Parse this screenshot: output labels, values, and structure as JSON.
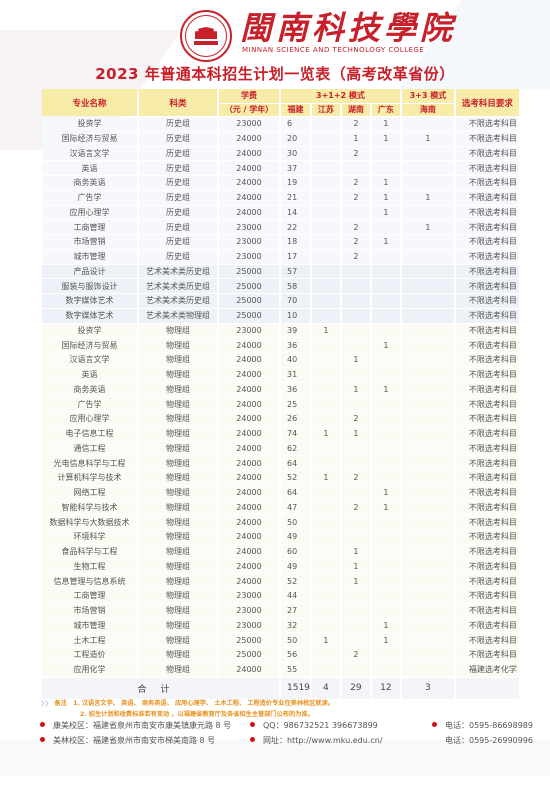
{
  "header": {
    "school_name": "閩南科技學院",
    "school_name_en": "MINNAN SCIENCE AND TECHNOLOGY COLLEGE",
    "title": "2023 年普通本科招生计划一览表（高考改革省份）"
  },
  "table": {
    "headers": {
      "major": "专业名称",
      "category": "科类",
      "fee": "学费",
      "fee_unit": "（元 / 学年）",
      "mode_312": "3+1+2 模式",
      "mode_33": "3+3 模式",
      "fujian": "福建",
      "jiangsu": "江苏",
      "hunan": "湖南",
      "guangdong": "广东",
      "hainan": "海南",
      "requirement": "选考科目要求"
    },
    "rows": [
      {
        "group": "hist",
        "major": "投资学",
        "category": "历史组",
        "fee": "23000",
        "fujian": "6",
        "jiangsu": "",
        "hunan": "2",
        "guangdong": "1",
        "hainan": "",
        "requirement": "不限选考科目"
      },
      {
        "group": "hist",
        "major": "国际经济与贸易",
        "category": "历史组",
        "fee": "24000",
        "fujian": "20",
        "jiangsu": "",
        "hunan": "1",
        "guangdong": "1",
        "hainan": "1",
        "requirement": "不限选考科目"
      },
      {
        "group": "hist",
        "major": "汉语言文学",
        "category": "历史组",
        "fee": "24000",
        "fujian": "30",
        "jiangsu": "",
        "hunan": "2",
        "guangdong": "",
        "hainan": "",
        "requirement": "不限选考科目"
      },
      {
        "group": "hist",
        "major": "英语",
        "category": "历史组",
        "fee": "24000",
        "fujian": "37",
        "jiangsu": "",
        "hunan": "",
        "guangdong": "",
        "hainan": "",
        "requirement": "不限选考科目"
      },
      {
        "group": "hist",
        "major": "商务英语",
        "category": "历史组",
        "fee": "24000",
        "fujian": "19",
        "jiangsu": "",
        "hunan": "2",
        "guangdong": "1",
        "hainan": "",
        "requirement": "不限选考科目"
      },
      {
        "group": "hist",
        "major": "广告学",
        "category": "历史组",
        "fee": "24000",
        "fujian": "21",
        "jiangsu": "",
        "hunan": "2",
        "guangdong": "1",
        "hainan": "1",
        "requirement": "不限选考科目"
      },
      {
        "group": "hist",
        "major": "应用心理学",
        "category": "历史组",
        "fee": "24000",
        "fujian": "14",
        "jiangsu": "",
        "hunan": "",
        "guangdong": "1",
        "hainan": "",
        "requirement": "不限选考科目"
      },
      {
        "group": "hist",
        "major": "工商管理",
        "category": "历史组",
        "fee": "23000",
        "fujian": "22",
        "jiangsu": "",
        "hunan": "2",
        "guangdong": "",
        "hainan": "1",
        "requirement": "不限选考科目"
      },
      {
        "group": "hist",
        "major": "市场营销",
        "category": "历史组",
        "fee": "23000",
        "fujian": "18",
        "jiangsu": "",
        "hunan": "2",
        "guangdong": "1",
        "hainan": "",
        "requirement": "不限选考科目"
      },
      {
        "group": "hist",
        "major": "城市管理",
        "category": "历史组",
        "fee": "23000",
        "fujian": "17",
        "jiangsu": "",
        "hunan": "2",
        "guangdong": "",
        "hainan": "",
        "requirement": "不限选考科目"
      },
      {
        "group": "art",
        "major": "产品设计",
        "category": "艺术美术类历史组",
        "fee": "25000",
        "fujian": "57",
        "jiangsu": "",
        "hunan": "",
        "guangdong": "",
        "hainan": "",
        "requirement": "不限选考科目"
      },
      {
        "group": "art",
        "major": "服装与服饰设计",
        "category": "艺术美术类历史组",
        "fee": "25000",
        "fujian": "58",
        "jiangsu": "",
        "hunan": "",
        "guangdong": "",
        "hainan": "",
        "requirement": "不限选考科目"
      },
      {
        "group": "art",
        "major": "数字媒体艺术",
        "category": "艺术美术类历史组",
        "fee": "25000",
        "fujian": "70",
        "jiangsu": "",
        "hunan": "",
        "guangdong": "",
        "hainan": "",
        "requirement": "不限选考科目"
      },
      {
        "group": "art",
        "major": "数字媒体艺术",
        "category": "艺术美术类物理组",
        "fee": "25000",
        "fujian": "10",
        "jiangsu": "",
        "hunan": "",
        "guangdong": "",
        "hainan": "",
        "requirement": "不限选考科目"
      },
      {
        "group": "phys",
        "major": "投资学",
        "category": "物理组",
        "fee": "23000",
        "fujian": "39",
        "jiangsu": "1",
        "hunan": "",
        "guangdong": "",
        "hainan": "",
        "requirement": "不限选考科目"
      },
      {
        "group": "phys",
        "major": "国际经济与贸易",
        "category": "物理组",
        "fee": "24000",
        "fujian": "36",
        "jiangsu": "",
        "hunan": "",
        "guangdong": "1",
        "hainan": "",
        "requirement": "不限选考科目"
      },
      {
        "group": "phys",
        "major": "汉语言文学",
        "category": "物理组",
        "fee": "24000",
        "fujian": "40",
        "jiangsu": "",
        "hunan": "1",
        "guangdong": "",
        "hainan": "",
        "requirement": "不限选考科目"
      },
      {
        "group": "phys",
        "major": "英语",
        "category": "物理组",
        "fee": "24000",
        "fujian": "31",
        "jiangsu": "",
        "hunan": "",
        "guangdong": "",
        "hainan": "",
        "requirement": "不限选考科目"
      },
      {
        "group": "phys",
        "major": "商务英语",
        "category": "物理组",
        "fee": "24000",
        "fujian": "36",
        "jiangsu": "",
        "hunan": "1",
        "guangdong": "1",
        "hainan": "",
        "requirement": "不限选考科目"
      },
      {
        "group": "phys",
        "major": "广告学",
        "category": "物理组",
        "fee": "24000",
        "fujian": "25",
        "jiangsu": "",
        "hunan": "",
        "guangdong": "",
        "hainan": "",
        "requirement": "不限选考科目"
      },
      {
        "group": "phys",
        "major": "应用心理学",
        "category": "物理组",
        "fee": "24000",
        "fujian": "26",
        "jiangsu": "",
        "hunan": "2",
        "guangdong": "",
        "hainan": "",
        "requirement": "不限选考科目"
      },
      {
        "group": "phys",
        "major": "电子信息工程",
        "category": "物理组",
        "fee": "24000",
        "fujian": "74",
        "jiangsu": "1",
        "hunan": "1",
        "guangdong": "",
        "hainan": "",
        "requirement": "不限选考科目"
      },
      {
        "group": "phys",
        "major": "通信工程",
        "category": "物理组",
        "fee": "24000",
        "fujian": "62",
        "jiangsu": "",
        "hunan": "",
        "guangdong": "",
        "hainan": "",
        "requirement": "不限选考科目"
      },
      {
        "group": "phys",
        "major": "光电信息科学与工程",
        "category": "物理组",
        "fee": "24000",
        "fujian": "64",
        "jiangsu": "",
        "hunan": "",
        "guangdong": "",
        "hainan": "",
        "requirement": "不限选考科目"
      },
      {
        "group": "phys",
        "major": "计算机科学与技术",
        "category": "物理组",
        "fee": "24000",
        "fujian": "52",
        "jiangsu": "1",
        "hunan": "2",
        "guangdong": "",
        "hainan": "",
        "requirement": "不限选考科目"
      },
      {
        "group": "phys",
        "major": "网络工程",
        "category": "物理组",
        "fee": "24000",
        "fujian": "64",
        "jiangsu": "",
        "hunan": "",
        "guangdong": "1",
        "hainan": "",
        "requirement": "不限选考科目"
      },
      {
        "group": "phys",
        "major": "智能科学与技术",
        "category": "物理组",
        "fee": "24000",
        "fujian": "47",
        "jiangsu": "",
        "hunan": "2",
        "guangdong": "1",
        "hainan": "",
        "requirement": "不限选考科目"
      },
      {
        "group": "phys",
        "major": "数据科学与大数据技术",
        "category": "物理组",
        "fee": "24000",
        "fujian": "50",
        "jiangsu": "",
        "hunan": "",
        "guangdong": "",
        "hainan": "",
        "requirement": "不限选考科目"
      },
      {
        "group": "phys",
        "major": "环境科学",
        "category": "物理组",
        "fee": "24000",
        "fujian": "49",
        "jiangsu": "",
        "hunan": "",
        "guangdong": "",
        "hainan": "",
        "requirement": "不限选考科目"
      },
      {
        "group": "phys",
        "major": "食品科学与工程",
        "category": "物理组",
        "fee": "24000",
        "fujian": "60",
        "jiangsu": "",
        "hunan": "1",
        "guangdong": "",
        "hainan": "",
        "requirement": "不限选考科目"
      },
      {
        "group": "phys",
        "major": "生物工程",
        "category": "物理组",
        "fee": "24000",
        "fujian": "49",
        "jiangsu": "",
        "hunan": "1",
        "guangdong": "",
        "hainan": "",
        "requirement": "不限选考科目"
      },
      {
        "group": "phys",
        "major": "信息管理与信息系统",
        "category": "物理组",
        "fee": "24000",
        "fujian": "52",
        "jiangsu": "",
        "hunan": "1",
        "guangdong": "",
        "hainan": "",
        "requirement": "不限选考科目"
      },
      {
        "group": "phys",
        "major": "工商管理",
        "category": "物理组",
        "fee": "23000",
        "fujian": "44",
        "jiangsu": "",
        "hunan": "",
        "guangdong": "",
        "hainan": "",
        "requirement": "不限选考科目"
      },
      {
        "group": "phys",
        "major": "市场营销",
        "category": "物理组",
        "fee": "23000",
        "fujian": "27",
        "jiangsu": "",
        "hunan": "",
        "guangdong": "",
        "hainan": "",
        "requirement": "不限选考科目"
      },
      {
        "group": "phys",
        "major": "城市管理",
        "category": "物理组",
        "fee": "23000",
        "fujian": "32",
        "jiangsu": "",
        "hunan": "",
        "guangdong": "1",
        "hainan": "",
        "requirement": "不限选考科目"
      },
      {
        "group": "phys",
        "major": "土木工程",
        "category": "物理组",
        "fee": "25000",
        "fujian": "50",
        "jiangsu": "1",
        "hunan": "",
        "guangdong": "1",
        "hainan": "",
        "requirement": "不限选考科目"
      },
      {
        "group": "phys",
        "major": "工程造价",
        "category": "物理组",
        "fee": "25000",
        "fujian": "56",
        "jiangsu": "",
        "hunan": "2",
        "guangdong": "",
        "hainan": "",
        "requirement": "不限选考科目"
      },
      {
        "group": "phys",
        "major": "应用化学",
        "category": "物理组",
        "fee": "24000",
        "fujian": "55",
        "jiangsu": "",
        "hunan": "",
        "guangdong": "",
        "hainan": "",
        "requirement": "福建选考化学"
      }
    ],
    "total": {
      "label": "合计",
      "fujian": "1519",
      "jiangsu": "4",
      "hunan": "29",
      "guangdong": "12",
      "hainan": "3"
    }
  },
  "notes": {
    "label": "备注",
    "line1": "1. 汉语言文学、 英语、 商务英语、 应用心理学、 土木工程、 工程造价专业在美林校区就读。",
    "line2": "2. 招生计划和收费标准若有变动 ，以福建省教育厅及各省招生主管部门公布的为准。"
  },
  "contacts": {
    "kangmei_campus": "康美校区：福建省泉州市南安市康美镇康元路 8 号",
    "meilin_campus": "美林校区：福建省泉州市南安市梯美南路 8 号",
    "qq": "QQ：986732521  396673899",
    "website": "网址：http://www.mku.edu.cn/",
    "phone1": "电话：0595-86698989",
    "phone2": "电话：0595-26990996"
  },
  "colors": {
    "brand_red": "#c8202a",
    "header_fill": "#f7eba8",
    "note_orange": "#e8901c"
  }
}
